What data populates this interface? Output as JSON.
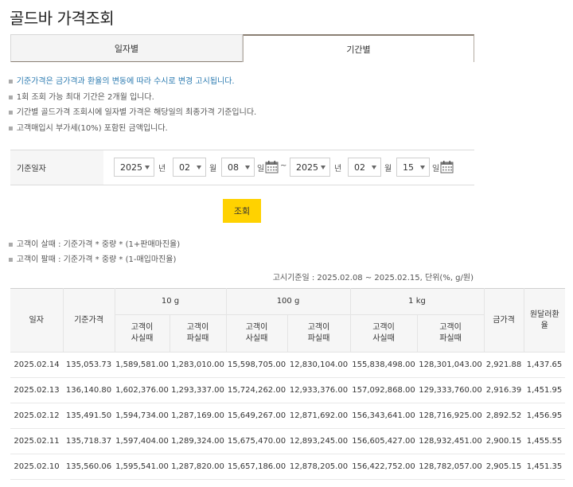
{
  "page": {
    "title": "골드바 가격조회"
  },
  "tabs": [
    {
      "label": "일자별",
      "active": false
    },
    {
      "label": "기간별",
      "active": true
    }
  ],
  "notes": [
    {
      "text": "기준가격은 금가격과 환율의 변동에 따라 수시로 변경 고시됩니다.",
      "highlight": true
    },
    {
      "text": "1회 조회 가능 최대 기간은 2개월 입니다.",
      "highlight": false
    },
    {
      "text": "기간별 골드가격 조회시에 일자별 가격은 해당일의 최종가격 기준입니다.",
      "highlight": false
    },
    {
      "text": "고객매입시 부가세(10%) 포함된 금액입니다.",
      "highlight": false
    }
  ],
  "search": {
    "label": "기준일자",
    "from": {
      "year": "2025",
      "month": "02",
      "day": "08"
    },
    "to": {
      "year": "2025",
      "month": "02",
      "day": "15"
    },
    "unit_year": "년",
    "unit_month": "월",
    "unit_day": "일",
    "tilde": "~",
    "button_label": "조회"
  },
  "formulas": [
    "고객이 살때 : 기준가격 * 중량 * (1+판매마진율)",
    "고객이 팔때 : 기준가격 * 중량 * (1-매입마진율)"
  ],
  "basis_text": "고시기준일 : 2025.02.08 ~ 2025.02.15, 단위(%, g/원)",
  "table": {
    "headers": {
      "date": "일자",
      "base_price": "기준가격",
      "g10": "10 g",
      "g100": "100 g",
      "kg1": "1 kg",
      "buy": "고객이\n사실때",
      "sell": "고객이\n파실때",
      "gold_price": "금가격",
      "fx": "원달러환율"
    },
    "rows": [
      [
        "2025.02.14",
        "135,053.73",
        "1,589,581.00",
        "1,283,010.00",
        "15,598,705.00",
        "12,830,104.00",
        "155,838,498.00",
        "128,301,043.00",
        "2,921.88",
        "1,437.65"
      ],
      [
        "2025.02.13",
        "136,140.80",
        "1,602,376.00",
        "1,293,337.00",
        "15,724,262.00",
        "12,933,376.00",
        "157,092,868.00",
        "129,333,760.00",
        "2,916.39",
        "1,451.95"
      ],
      [
        "2025.02.12",
        "135,491.50",
        "1,594,734.00",
        "1,287,169.00",
        "15,649,267.00",
        "12,871,692.00",
        "156,343,641.00",
        "128,716,925.00",
        "2,892.52",
        "1,456.95"
      ],
      [
        "2025.02.11",
        "135,718.37",
        "1,597,404.00",
        "1,289,324.00",
        "15,675,470.00",
        "12,893,245.00",
        "156,605,427.00",
        "128,932,451.00",
        "2,900.15",
        "1,455.55"
      ],
      [
        "2025.02.10",
        "135,560.06",
        "1,595,541.00",
        "1,287,820.00",
        "15,657,186.00",
        "12,878,205.00",
        "156,422,752.00",
        "128,782,057.00",
        "2,905.15",
        "1,451.35"
      ]
    ]
  }
}
